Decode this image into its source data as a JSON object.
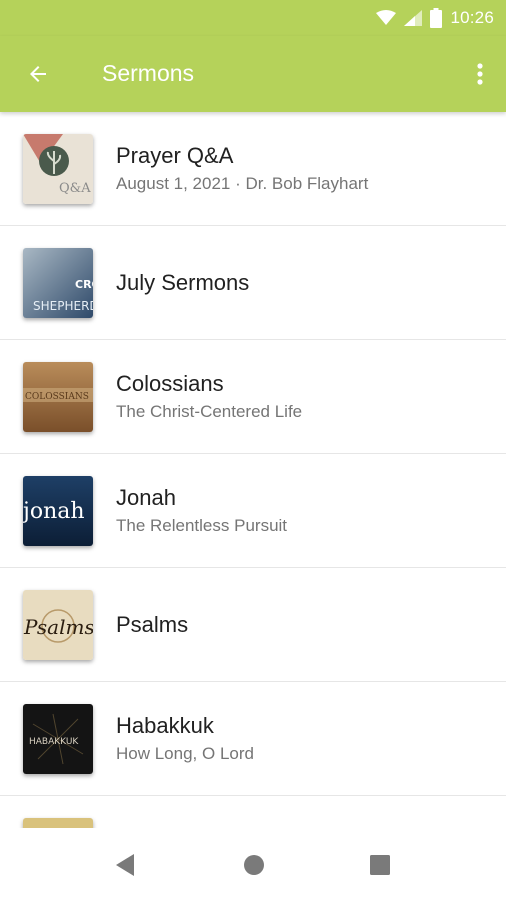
{
  "status_bar": {
    "time": "10:26",
    "icons": [
      "wifi-icon",
      "signal-icon",
      "battery-icon"
    ]
  },
  "app_bar": {
    "title": "Sermons",
    "back_icon": "arrow-left-icon",
    "menu_icon": "more-vert-icon",
    "color": "#b5d25a"
  },
  "items": [
    {
      "title": "Prayer Q&A",
      "subtitle": "August 1, 2021 · Dr. Bob Flayhart",
      "thumb_text": "Q&A"
    },
    {
      "title": "July Sermons",
      "subtitle": "",
      "thumb_text": "SHEPHERD"
    },
    {
      "title": "Colossians",
      "subtitle": "The Christ-Centered Life",
      "thumb_text": "COLOSSIANS"
    },
    {
      "title": "Jonah",
      "subtitle": "The Relentless Pursuit",
      "thumb_text": "jonah"
    },
    {
      "title": "Psalms",
      "subtitle": "",
      "thumb_text": "Psalms"
    },
    {
      "title": "Habakkuk",
      "subtitle": "How Long, O Lord",
      "thumb_text": "HABAKKUK"
    }
  ],
  "nav_bar": {
    "icons": [
      "back-triangle-icon",
      "home-circle-icon",
      "recents-square-icon"
    ]
  }
}
